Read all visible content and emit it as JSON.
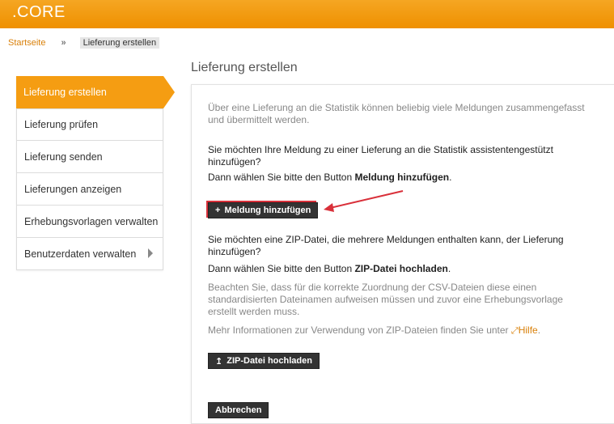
{
  "header": {
    "brand": ".CORE"
  },
  "breadcrumb": {
    "home": "Startseite",
    "separator": "»",
    "current": "Lieferung erstellen"
  },
  "page": {
    "title": "Lieferung erstellen"
  },
  "sidebar": {
    "items": [
      {
        "label": "Lieferung erstellen"
      },
      {
        "label": "Lieferung prüfen"
      },
      {
        "label": "Lieferung senden"
      },
      {
        "label": "Lieferungen anzeigen"
      },
      {
        "label": "Erhebungsvorlagen verwalten"
      },
      {
        "label": "Benutzerdaten verwalten"
      }
    ]
  },
  "content": {
    "intro": "Über eine Lieferung an die Statistik können beliebig viele Meldungen zusammengefasst und übermittelt werden.",
    "assist_question": "Sie möchten Ihre Meldung zu einer Lieferung an die Statistik assistentengestützt hinzufügen?",
    "assist_hint_prefix": "Dann wählen Sie bitte den Button ",
    "assist_hint_bold": "Meldung hinzufügen",
    "assist_hint_suffix": ".",
    "add_button": "Meldung hinzufügen",
    "add_button_icon": "+",
    "zip_question": "Sie möchten eine ZIP-Datei, die mehrere Meldungen enthalten kann, der Lieferung hinzufügen?",
    "zip_hint_prefix": "Dann wählen Sie bitte den Button ",
    "zip_hint_bold": "ZIP-Datei hochladen",
    "zip_hint_suffix": ".",
    "zip_note": "Beachten Sie, dass für die korrekte Zuordnung der CSV-Dateien diese einen standardisierten Dateinamen aufweisen müssen und zuvor eine Erhebungsvorlage erstellt werden muss.",
    "more_info_prefix": "Mehr Informationen zur Verwendung von ZIP-Dateien finden Sie unter ",
    "help_link": "Hilfe",
    "help_suffix": ".",
    "upload_button": "ZIP-Datei hochladen",
    "upload_button_icon": "↥",
    "cancel_button": "Abbrechen"
  },
  "colors": {
    "brand_orange": "#f59d12",
    "link_orange": "#d9800a",
    "button_dark": "#333333",
    "annotation_red": "#d9303a"
  }
}
